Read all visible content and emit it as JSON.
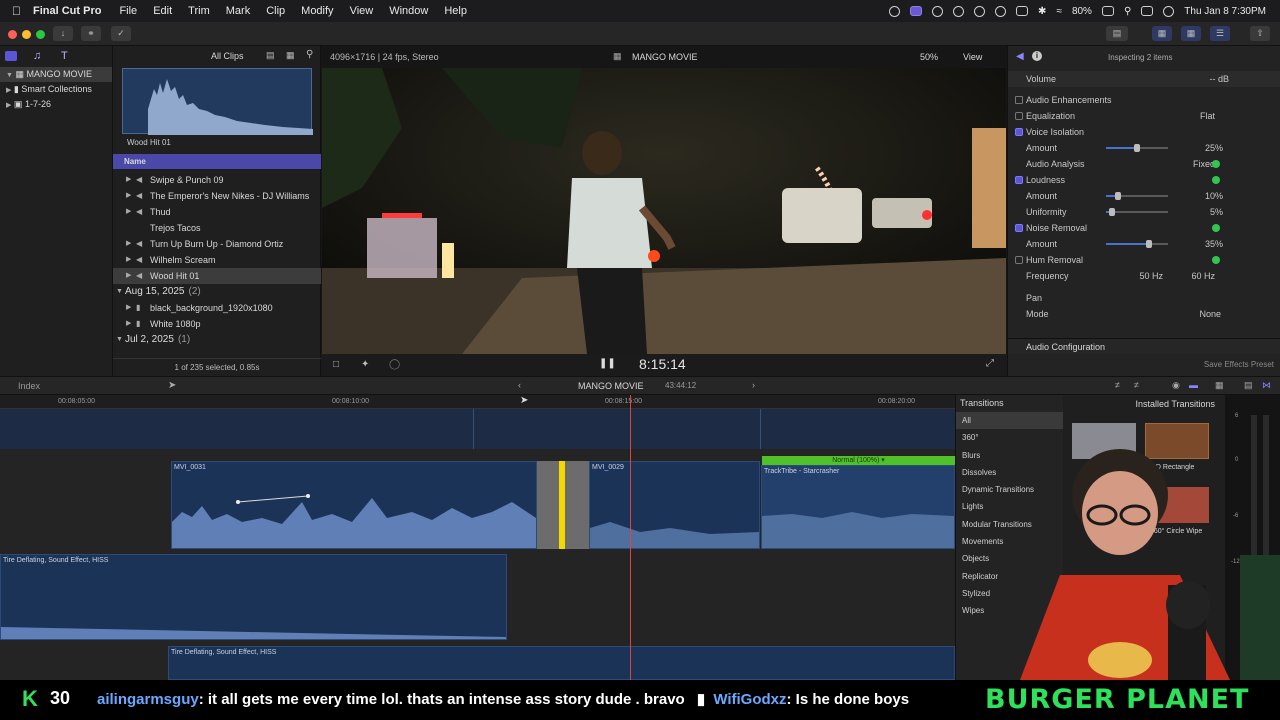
{
  "menubar": {
    "app_name": "Final Cut Pro",
    "menus": [
      "File",
      "Edit",
      "Trim",
      "Mark",
      "Clip",
      "Modify",
      "View",
      "Window",
      "Help"
    ],
    "battery": "80%",
    "clock": "Thu Jan 8  7:30PM"
  },
  "library": {
    "items": [
      {
        "label": "MANGO MOVIE",
        "icon": "library-icon",
        "selected": true
      },
      {
        "label": "Smart Collections",
        "icon": "folder-icon",
        "selected": false
      },
      {
        "label": "1-7-26",
        "icon": "event-icon",
        "selected": false
      }
    ]
  },
  "browser": {
    "filter": "All Clips",
    "thumb_label": "Wood Hit 01",
    "column_header": "Name",
    "rows": [
      {
        "label": "Swipe & Punch 09",
        "selected": false,
        "audio": true
      },
      {
        "label": "The Emperor's New Nikes - DJ Williams",
        "selected": false,
        "audio": true
      },
      {
        "label": "Thud",
        "selected": false,
        "audio": true
      },
      {
        "label": "Trejos Tacos",
        "selected": false,
        "audio": false
      },
      {
        "label": "Turn Up Burn Up - Diamond Ortiz",
        "selected": false,
        "audio": true
      },
      {
        "label": "Wilhelm Scream",
        "selected": false,
        "audio": true
      },
      {
        "label": "Wood Hit 01",
        "selected": true,
        "audio": true
      }
    ],
    "groups": [
      {
        "date": "Aug 15, 2025",
        "count": "(2)",
        "rows": [
          "black_background_1920x1080",
          "White 1080p"
        ]
      },
      {
        "date": "Jul 2, 2025",
        "count": "(1)",
        "rows": []
      }
    ],
    "status": "1 of 235 selected, 0.85s"
  },
  "viewer": {
    "format": "4096×1716 | 24 fps, Stereo",
    "title": "MANGO MOVIE",
    "zoom": "50%",
    "view_label": "View",
    "timecode": "8:15:14"
  },
  "inspector": {
    "header": "Inspecting 2 items",
    "volume_label": "Volume",
    "volume_value": "-- dB",
    "section": "Audio Enhancements",
    "rows": [
      {
        "label": "Equalization",
        "value": "Flat",
        "checkbox": "off"
      },
      {
        "label": "Voice Isolation",
        "value": "",
        "checkbox": "on"
      },
      {
        "label": "Amount",
        "value": "25",
        "unit": "%",
        "slider": 0.25
      },
      {
        "label": "Audio Analysis",
        "value": "Fixed",
        "ok": true
      },
      {
        "label": "Loudness",
        "value": "",
        "checkbox": "on",
        "ok": true
      },
      {
        "label": "Amount",
        "value": "10",
        "unit": "%",
        "slider": 0.1
      },
      {
        "label": "Uniformity",
        "value": "5",
        "unit": "%",
        "slider": 0.05
      },
      {
        "label": "Noise Removal",
        "value": "",
        "checkbox": "on",
        "ok": true
      },
      {
        "label": "Amount",
        "value": "35",
        "unit": "%",
        "slider": 0.35
      },
      {
        "label": "Hum Removal",
        "value": "",
        "checkbox": "off",
        "ok": true
      },
      {
        "label": "Frequency",
        "value": "50 Hz",
        "value2": "60 Hz"
      }
    ],
    "pan_label": "Pan",
    "mode_label": "Mode",
    "mode_value": "None",
    "audio_config": "Audio Configuration",
    "save_preset": "Save Effects Preset"
  },
  "timeline": {
    "index_label": "Index",
    "project": "MANGO MOVIE",
    "duration": "43:44:12",
    "ruler": [
      "00:08:05:00",
      "00:08:10:00",
      "00:08:15:00",
      "00:08:20:00"
    ],
    "clips": {
      "a": "MVI_0031",
      "b": "MVI_0029",
      "c": "TrackTribe - Starcrasher",
      "c_badge": "Normal (100%) ▾",
      "d": "Tire Deflating, Sound Effect, HISS",
      "e": "Tire Deflating, Sound Effect, HISS"
    }
  },
  "transitions": {
    "title": "Transitions",
    "installed": "Installed Transitions",
    "categories": [
      "All",
      "360°",
      "Blurs",
      "Dissolves",
      "Dynamic Transitions",
      "Lights",
      "Modular Transitions",
      "Movements",
      "Objects",
      "Replicator",
      "Stylized",
      "Wipes"
    ],
    "thumbs": [
      "3D Rectangle",
      "360° Circle Wipe"
    ],
    "meter_labels": [
      "6",
      "0",
      "-6",
      "-12"
    ]
  },
  "ticker": {
    "count": "30",
    "user1": "ailingarmsguy",
    "msg1": ": it all gets me every time lol. thats an intense ass story dude . bravo",
    "user2": "WifiGodxz",
    "msg2": ": Is he done boys",
    "brand": "BURGER PLANET"
  },
  "colors": {
    "accent": "#6a5acd",
    "clip_blue": "#1c3358",
    "green_badge": "#4fc22a",
    "playhead": "#e0443a",
    "ticker_green": "#2fe05a"
  }
}
